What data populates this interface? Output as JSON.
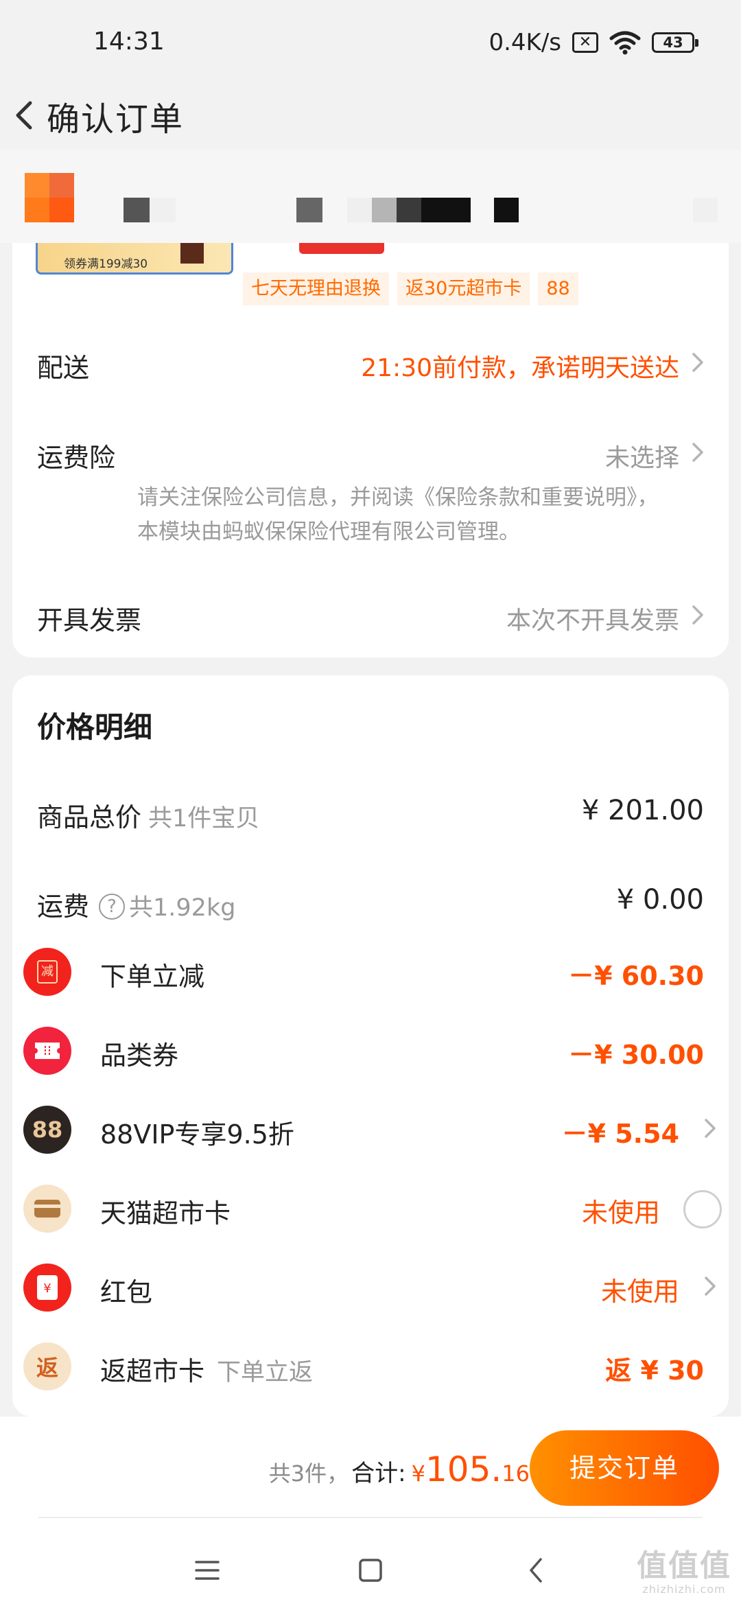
{
  "status_bar": {
    "time": "14:31",
    "network_speed": "0.4K/s",
    "battery_level": "43",
    "icons": [
      "sim-disabled-icon",
      "wifi-icon",
      "battery-icon"
    ]
  },
  "header": {
    "title": "确认订单",
    "back_icon": "chevron-left-icon"
  },
  "product": {
    "thumb_text": "领券满199减30",
    "tags": [
      "七天无理由退换",
      "返30元超市卡",
      "88"
    ]
  },
  "order_options": {
    "delivery": {
      "label": "配送",
      "value": "21:30前付款，承诺明天送达"
    },
    "shipping_insurance": {
      "label": "运费险",
      "value": "未选择",
      "note": "请关注保险公司信息，并阅读《保险条款和重要说明》，本模块由蚂蚁保保险代理有限公司管理。"
    },
    "invoice": {
      "label": "开具发票",
      "value": "本次不开具发票"
    }
  },
  "price_details": {
    "title": "价格明细",
    "subtotal": {
      "label": "商品总价",
      "sub": "共1件宝贝",
      "amount": "¥ 201.00"
    },
    "shipping": {
      "label": "运费",
      "help_icon": "?",
      "sub": "共1.92kg",
      "amount": "¥ 0.00"
    },
    "discounts": [
      {
        "icon": "instant-discount-icon",
        "icon_text": "减",
        "label": "下单立减",
        "value": "－¥ 60.30"
      },
      {
        "icon": "category-coupon-icon",
        "label": "品类券",
        "value": "－¥ 30.00"
      },
      {
        "icon": "88vip-icon",
        "icon_text": "88",
        "label": "88VIP专享9.5折",
        "value": "－¥ 5.54"
      },
      {
        "icon": "tmall-card-icon",
        "label": "天猫超市卡",
        "value": "未使用"
      },
      {
        "icon": "red-packet-icon",
        "icon_text": "¥",
        "label": "红包",
        "value": "未使用"
      },
      {
        "icon": "cashback-icon",
        "icon_text": "返",
        "label": "返超市卡",
        "sub": "下单立返",
        "value": "返 ¥ 30"
      }
    ]
  },
  "bottom_bar": {
    "count": "共3件，",
    "total_label": "合计:",
    "currency": "¥",
    "total_int": "105.",
    "total_dec": "16",
    "submit_label": "提交订单"
  },
  "nav_bar": {
    "buttons": [
      "menu-icon",
      "home-square-icon",
      "back-nav-icon"
    ]
  },
  "watermark": {
    "main": "值值值",
    "sub": "zhizhizhi.com"
  },
  "colors": {
    "accent": "#ff5000",
    "tag_bg": "#fff2e6",
    "button_gradient_start": "#ff9000",
    "button_gradient_end": "#ff4f00",
    "page_bg": "#f2f2f2"
  }
}
